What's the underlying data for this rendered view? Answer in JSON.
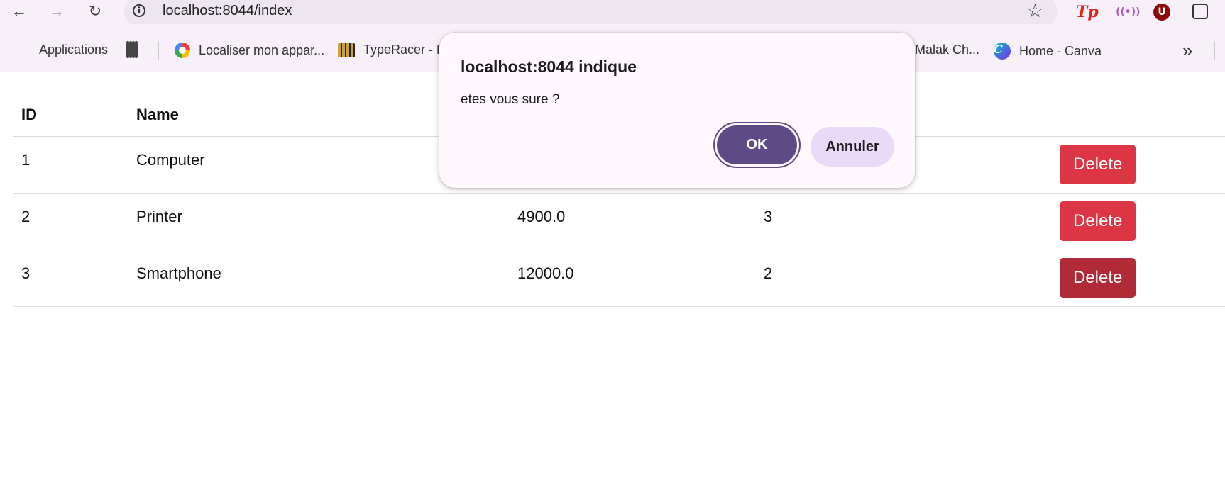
{
  "browser": {
    "url": "localhost:8044/index",
    "bookmarks": [
      {
        "label": "Applications",
        "icon": "apps-grid-icon"
      },
      {
        "label": "",
        "icon": "tab-groups-icon"
      },
      {
        "label": "Localiser mon appar...",
        "icon": "google-icon"
      },
      {
        "label": "TypeRacer - P",
        "icon": "typeracer-icon"
      },
      {
        "label": "Malak Ch...",
        "icon": ""
      },
      {
        "label": "Home - Canva",
        "icon": "canva-icon"
      }
    ],
    "extensions": {
      "tp": "Tp",
      "radio": "((•))",
      "u": "U"
    },
    "more_label": "»",
    "colors": {
      "chrome_bg": "#f8f0f8",
      "omnibox_bg": "#ede5ef"
    }
  },
  "table": {
    "headers": [
      "ID",
      "Name",
      "",
      "",
      ""
    ],
    "rows": [
      {
        "id": "1",
        "name": "Computer",
        "price": "",
        "qty": "",
        "action": "Delete"
      },
      {
        "id": "2",
        "name": "Printer",
        "price": "4900.0",
        "qty": "3",
        "action": "Delete"
      },
      {
        "id": "3",
        "name": "Smartphone",
        "price": "12000.0",
        "qty": "2",
        "action": "Delete"
      }
    ],
    "colors": {
      "delete_bg": "#dc3545",
      "delete_hover_bg": "#b02a37"
    }
  },
  "dialog": {
    "title": "localhost:8044 indique",
    "message": "etes vous sure ?",
    "ok_label": "OK",
    "cancel_label": "Annuler",
    "colors": {
      "ok_bg": "#5e4b85",
      "cancel_bg": "#ead9f8"
    }
  }
}
